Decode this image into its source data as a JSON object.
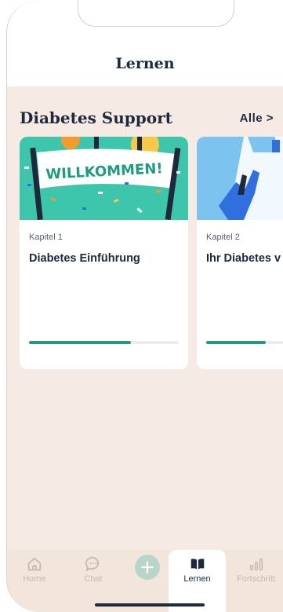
{
  "header": {
    "title": "Lernen"
  },
  "section": {
    "title": "Diabetes Support",
    "see_all": "Alle >"
  },
  "cards": [
    {
      "kicker": "Kapitel 1",
      "title": "Diabetes Einführung",
      "banner_text": "WILLKOMMEN!",
      "progress": 0.68
    },
    {
      "kicker": "Kapitel 2",
      "title": "Ihr Diabetes v",
      "progress": 0.4
    }
  ],
  "tabs": [
    {
      "label": "Home",
      "icon": "home-icon"
    },
    {
      "label": "Chat",
      "icon": "chat-icon"
    },
    {
      "label": "",
      "icon": "add-icon"
    },
    {
      "label": "Lernen",
      "icon": "book-icon",
      "active": true
    },
    {
      "label": "Fortschritt",
      "icon": "chart-icon"
    }
  ],
  "colors": {
    "accent": "#1f9b7e",
    "background": "#f6ebe4",
    "text": "#1e2a3b",
    "banner_bg": "#3ec6ad"
  }
}
